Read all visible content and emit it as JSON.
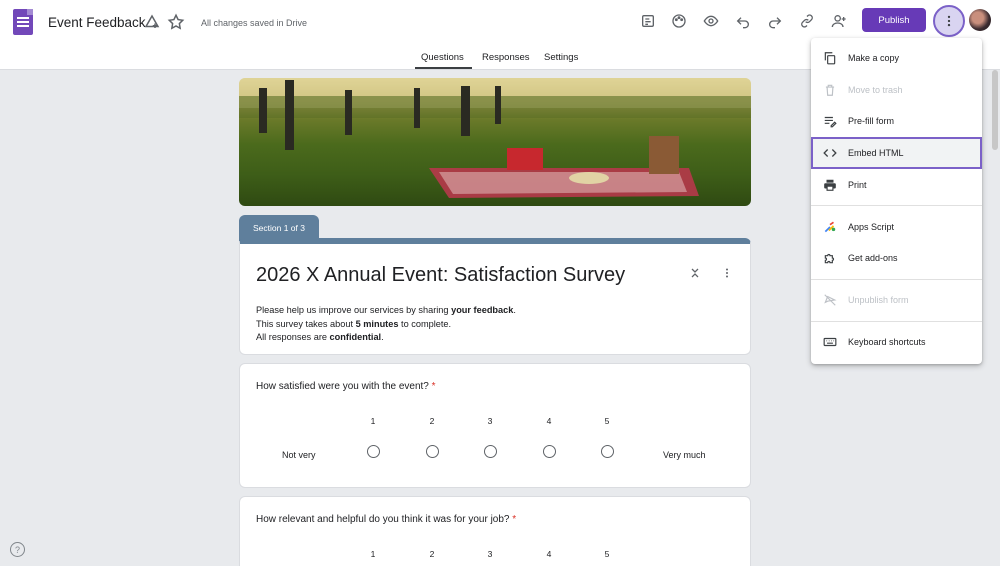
{
  "header": {
    "doc_title": "Event Feedback",
    "saved_status": "All changes saved in Drive",
    "publish_label": "Publish"
  },
  "tabs": [
    {
      "label": "Questions"
    },
    {
      "label": "Responses"
    },
    {
      "label": "Settings"
    }
  ],
  "section": {
    "label": "Section 1 of 3"
  },
  "form": {
    "title": "2026 X Annual Event: Satisfaction Survey",
    "desc_line1_pre": "Please help us improve our services by sharing ",
    "desc_line1_bold": "your feedback",
    "desc_line1_post": ".",
    "desc_line2_pre": "This survey takes about ",
    "desc_line2_bold": "5 minutes",
    "desc_line2_post": " to complete.",
    "desc_line3_pre": "All responses are ",
    "desc_line3_bold": "confidential",
    "desc_line3_post": "."
  },
  "questions": [
    {
      "text": "How satisfied were you with the event?",
      "required_mark": "*",
      "scale": [
        "1",
        "2",
        "3",
        "4",
        "5"
      ],
      "low_label": "Not very",
      "high_label": "Very much"
    },
    {
      "text": "How relevant and helpful do you think it was for your job?",
      "required_mark": "*",
      "scale": [
        "1",
        "2",
        "3",
        "4",
        "5"
      ]
    }
  ],
  "menu": {
    "items": [
      {
        "label": "Make a copy",
        "icon": "copy-icon"
      },
      {
        "label": "Move to trash",
        "icon": "trash-icon"
      },
      {
        "label": "Pre-fill form",
        "icon": "prefill-icon"
      },
      {
        "label": "Embed HTML",
        "icon": "code-icon"
      },
      {
        "label": "Print",
        "icon": "print-icon"
      },
      {
        "label": "Apps Script",
        "icon": "apps-script-icon"
      },
      {
        "label": "Get add-ons",
        "icon": "puzzle-icon"
      },
      {
        "label": "Unpublish form",
        "icon": "unpublish-icon"
      },
      {
        "label": "Keyboard shortcuts",
        "icon": "keyboard-icon"
      }
    ]
  },
  "help": {
    "glyph": "?"
  },
  "colors": {
    "accent": "#673ab7",
    "section": "#5f7f9c",
    "required": "#d93025"
  }
}
